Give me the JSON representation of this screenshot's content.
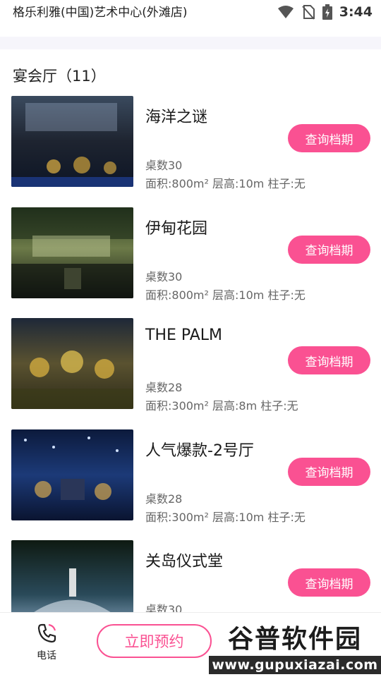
{
  "status_bar": {
    "title": "格乐利雅(中国)艺术中心(外滩店)",
    "time": "3:44"
  },
  "list": {
    "title": "宴会厅（11）"
  },
  "halls": [
    {
      "name": "海洋之谜",
      "button": "查询档期",
      "tables": "桌数30",
      "specs": "面积:800m² 层高:10m 柱子:无"
    },
    {
      "name": "伊甸花园",
      "button": "查询档期",
      "tables": "桌数30",
      "specs": "面积:800m² 层高:10m 柱子:无"
    },
    {
      "name": "THE PALM",
      "button": "查询档期",
      "tables": "桌数28",
      "specs": "面积:300m² 层高:8m 柱子:无"
    },
    {
      "name": "人气爆款-2号厅",
      "button": "查询档期",
      "tables": "桌数28",
      "specs": "面积:300m² 层高:10m 柱子:无"
    },
    {
      "name": "关岛仪式堂",
      "button": "查询档期",
      "tables": "桌数30",
      "specs": ""
    }
  ],
  "bottom_bar": {
    "phone_label": "电话",
    "reserve_label": "立即预约"
  },
  "watermark": {
    "title": "谷普软件园",
    "url": "www.gupuxiazai.com"
  },
  "colors": {
    "accent": "#fa5192",
    "watermark_bg": "#2b2b2b"
  }
}
